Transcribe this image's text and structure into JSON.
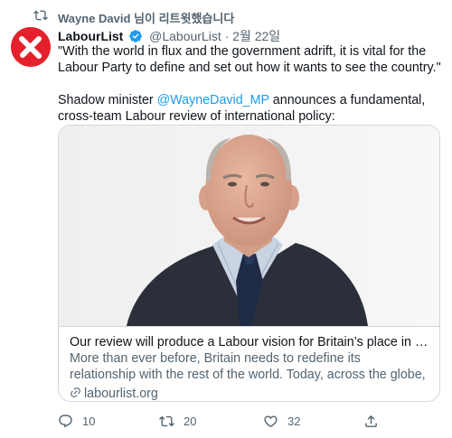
{
  "retweet_banner": {
    "text": "Wayne David 님이 리트윗했습니다",
    "icon": "retweet-icon"
  },
  "author": {
    "display_name": "LabourList",
    "handle": "@LabourList",
    "separator": "·",
    "date": "2월 22일",
    "avatar_color": "#e4202c",
    "verified": true
  },
  "tweet": {
    "quote": "\"With the world in flux and the government adrift, it is vital for the Labour Party to define and set out how it wants to see the country.\"",
    "line2_prefix": "Shadow minister ",
    "mention": "@WayneDavid_MP",
    "line2_suffix": " announces a fundamental, cross-team Labour review of international policy:"
  },
  "card": {
    "title": "Our review will produce a Labour vision for Britain’s place in the world ...",
    "description": "More than ever before, Britain needs to redefine its relationship with the rest of the world. Today, across the globe, competition between nation...",
    "domain": "labourlist.org"
  },
  "actions": {
    "reply_count": "10",
    "retweet_count": "20",
    "like_count": "32"
  },
  "colors": {
    "accent": "#1d9bf0",
    "secondary_text": "#536471",
    "border": "#cfd9de"
  }
}
